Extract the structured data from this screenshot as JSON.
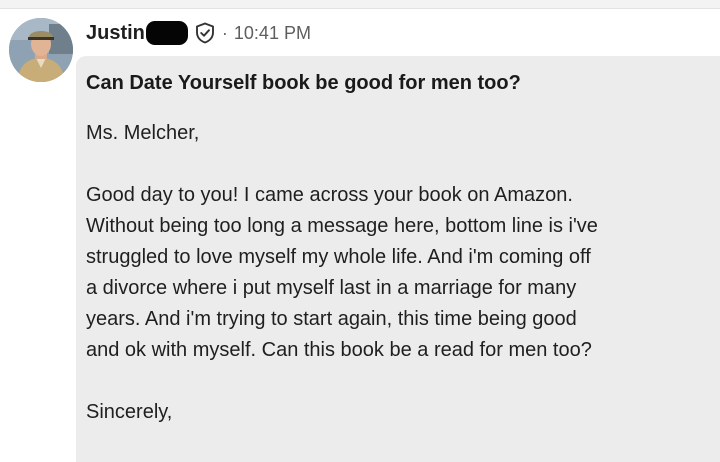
{
  "message": {
    "sender_name": "Justin",
    "separator": "·",
    "timestamp": "10:41 PM",
    "subject": "Can Date Yourself book be good for men too?",
    "salutation": "Ms. Melcher,",
    "body_lines": [
      "Good day to you!  I came across your book on Amazon.",
      "Without being too long a message here, bottom line is i've",
      "struggled to love myself my whole life.  And i'm coming off",
      "a divorce where i put myself last in a marriage for many",
      "years.  And i'm trying to start again, this time being good",
      "and ok with myself.  Can this book be a read for men too?"
    ],
    "closing": "Sincerely,"
  },
  "icons": {
    "verified": "shield-check-icon",
    "avatar": "avatar"
  },
  "colors": {
    "bubble_background": "#ececec",
    "redaction": "#050505",
    "timestamp": "#5e5e5e"
  }
}
